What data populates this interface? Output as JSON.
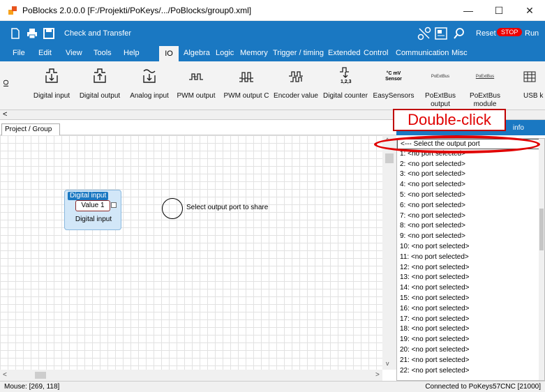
{
  "window": {
    "title": "PoBlocks 2.0.0.0 [F:/Projekti/PoKeys/.../PoBlocks/group0.xml]",
    "minimize": "—",
    "maximize": "☐",
    "close": "✕"
  },
  "ribbon": {
    "check_transfer": "Check and Transfer",
    "reset": "Reset",
    "stop": "STOP",
    "run": "Run",
    "icons": [
      "new-file-icon",
      "print-icon",
      "save-icon",
      "connect-icon",
      "monitor-icon",
      "search-icon"
    ]
  },
  "menu": {
    "items": [
      "File",
      "Edit",
      "View",
      "Tools",
      "Help"
    ],
    "tabs": [
      "IO",
      "Algebra",
      "Logic",
      "Memory",
      "Trigger / timing",
      "Extended",
      "Control",
      "Communication",
      "Misc"
    ]
  },
  "toolbar": {
    "side_label": "IO",
    "tools": [
      {
        "label": "Digital input",
        "icon": "digital-input-icon"
      },
      {
        "label": "Digital output",
        "icon": "digital-output-icon"
      },
      {
        "label": "Analog input",
        "icon": "analog-input-icon"
      },
      {
        "label": "PWM output",
        "icon": "pwm-output-icon"
      },
      {
        "label": "PWM output C",
        "icon": "pwm-output-c-icon"
      },
      {
        "label": "Encoder value",
        "icon": "encoder-value-icon"
      },
      {
        "label": "Digital counter",
        "icon": "digital-counter-icon"
      },
      {
        "label": "EasySensors",
        "icon": "easysensors-icon"
      },
      {
        "label": "PoExtBus output",
        "icon": "poextbus-icon"
      },
      {
        "label": "PoExtBus module",
        "icon": "poextbus-module-icon"
      },
      {
        "label": "USB k",
        "icon": "usb-keyboard-icon"
      }
    ],
    "sensor_icon_text": "°C mV Sensor",
    "poextbus_icon_text": "PoExtBus",
    "counter_icon_text": "1,2,3"
  },
  "project": {
    "tab": "Project / Group",
    "block": {
      "title": "Digital input",
      "value": "Value 1",
      "subtitle": "Digital input"
    },
    "circle_label": "Select output port to share"
  },
  "right_panel": {
    "header": "info",
    "items": [
      "<--- Select the output port",
      "1: <no port selected>",
      "2: <no port selected>",
      "3: <no port selected>",
      "4: <no port selected>",
      "5: <no port selected>",
      "6: <no port selected>",
      "7: <no port selected>",
      "8: <no port selected>",
      "9: <no port selected>",
      "10: <no port selected>",
      "11: <no port selected>",
      "12: <no port selected>",
      "13: <no port selected>",
      "14: <no port selected>",
      "15: <no port selected>",
      "16: <no port selected>",
      "17: <no port selected>",
      "18: <no port selected>",
      "19: <no port selected>",
      "20: <no port selected>",
      "21: <no port selected>",
      "22: <no port selected>"
    ]
  },
  "annotation": {
    "text": "Double-click"
  },
  "status": {
    "mouse": "Mouse: [269, 118]",
    "connection": "Connected to PoKeys57CNC [21000]"
  }
}
